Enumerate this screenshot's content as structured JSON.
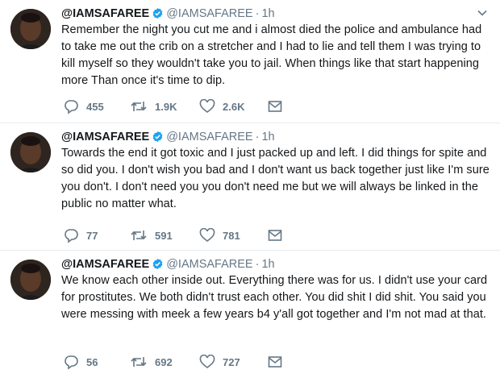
{
  "colors": {
    "verified": "#1da1f2",
    "muted": "#657786",
    "text": "#14171a",
    "divider": "#e6ecf0"
  },
  "tweets": [
    {
      "name": "@IAMSAFAREE",
      "handle": "@IAMSAFAREE",
      "dot": "·",
      "time": "1h",
      "text": "Remember the night you cut me and i almost died the police and ambulance had to take me out the crib on a stretcher and I had to lie and tell them I was trying to kill myself so they wouldn't take you to jail. When things like that start happening more Than once it's time to dip.",
      "replies": "455",
      "retweets": "1.9K",
      "likes": "2.6K"
    },
    {
      "name": "@IAMSAFAREE",
      "handle": "@IAMSAFAREE",
      "dot": "·",
      "time": "1h",
      "text": "Towards the end it got toxic and I just packed up and left. I did things for spite and so did you. I don't wish you bad and I don't want us back together just like I'm sure you don't. I don't need you you don't need me but we will always be linked in the public no matter what.",
      "replies": "77",
      "retweets": "591",
      "likes": "781"
    },
    {
      "name": "@IAMSAFAREE",
      "handle": "@IAMSAFAREE",
      "dot": "·",
      "time": "1h",
      "text": "We know each other inside out. Everything there was for us. I didn't use your card for prostitutes.  We both didn't trust each other. You did shit I did shit. You said you were messing with meek a few years b4 y'all got together and I'm not mad at that.",
      "replies": "56",
      "retweets": "692",
      "likes": "727"
    }
  ]
}
